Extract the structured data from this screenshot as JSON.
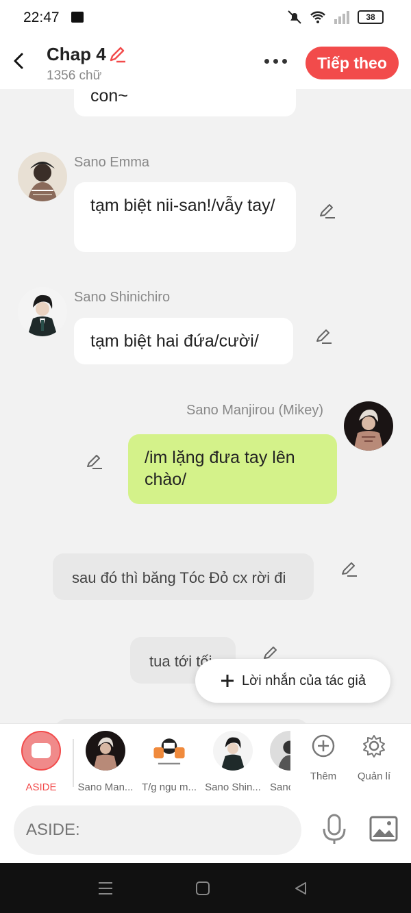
{
  "status_bar": {
    "time": "22:47",
    "battery": "38"
  },
  "header": {
    "title": "Chap 4",
    "word_count": "1356 chữ",
    "next_label": "Tiếp theo"
  },
  "messages": [
    {
      "text": "con~"
    },
    {
      "speaker": "Sano Emma",
      "text": "tạm biệt nii-san!/vẫy tay/"
    },
    {
      "speaker": "Sano Shinichiro",
      "text": "tạm biệt hai đứa/cười/"
    },
    {
      "speaker": "Sano Manjirou (Mikey)",
      "text": "/im lặng đưa tay lên chào/"
    },
    {
      "text": "sau đó thì băng Tóc Đỏ cx rời đi"
    },
    {
      "text": "tua tới tối"
    }
  ],
  "author_note": {
    "label": "Lời nhắn của tác giả"
  },
  "characters": [
    {
      "label": "ASIDE"
    },
    {
      "label": "Sano Man..."
    },
    {
      "label": "T/g ngu m..."
    },
    {
      "label": "Sano Shin..."
    },
    {
      "label": "Sano"
    }
  ],
  "actions": {
    "add_label": "Thêm",
    "manage_label": "Quản lí"
  },
  "input": {
    "placeholder": "ASIDE:"
  },
  "colors": {
    "accent": "#f24b4b",
    "self_bubble": "#d4f28a",
    "narration_bubble": "#e8e8e8"
  }
}
